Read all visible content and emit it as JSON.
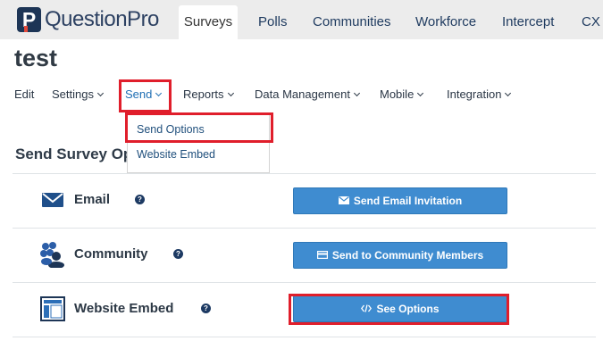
{
  "app": {
    "logo_text": "QuestionPro",
    "logo_glyph": "P"
  },
  "top_nav": {
    "tabs": [
      {
        "label": "Surveys",
        "active": true
      },
      {
        "label": "Polls"
      },
      {
        "label": "Communities"
      },
      {
        "label": "Workforce"
      },
      {
        "label": "Intercept"
      },
      {
        "label": "CX"
      }
    ]
  },
  "page": {
    "title": "test"
  },
  "sub_nav": {
    "edit": "Edit",
    "settings": "Settings",
    "send": "Send",
    "reports": "Reports",
    "data_management": "Data Management",
    "mobile": "Mobile",
    "integration": "Integration"
  },
  "send_menu": {
    "items": [
      {
        "label": "Send Options"
      },
      {
        "label": "Website Embed"
      }
    ]
  },
  "section": {
    "title": "Send Survey Options"
  },
  "rows": [
    {
      "label": "Email",
      "icon": "envelope-icon",
      "button": "Send Email Invitation",
      "button_icon": "envelope-icon"
    },
    {
      "label": "Community",
      "icon": "people-icon",
      "button": "Send to Community Members",
      "button_icon": "card-icon"
    },
    {
      "label": "Website Embed",
      "icon": "website-layout-icon",
      "button": "See Options",
      "button_icon": "code-icon"
    }
  ],
  "help_glyph": "?",
  "colors": {
    "highlight": "#e01e2b",
    "button": "#3f8cd0",
    "brand_dark": "#1d3556"
  }
}
